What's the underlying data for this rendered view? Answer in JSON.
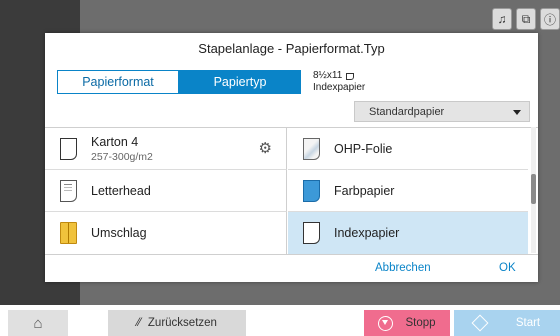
{
  "dialog": {
    "title": "Stapelanlage - Papierformat.Typ",
    "tabs": [
      {
        "label": "Papierformat",
        "active": false
      },
      {
        "label": "Papiertyp",
        "active": true
      }
    ],
    "paper_info": {
      "size": "8½x11",
      "type": "Indexpapier"
    },
    "dropdown_value": "Standardpapier",
    "paper_types": [
      {
        "label": "Karton 4",
        "sub": "257-300g/m2",
        "icon": "document-icon",
        "settings_icon": "gear-icon",
        "selected": false
      },
      {
        "label": "OHP-Folie",
        "icon": "transparency-icon",
        "selected": false
      },
      {
        "label": "Letterhead",
        "icon": "letterhead-icon",
        "selected": false
      },
      {
        "label": "Farbpapier",
        "icon": "colored-paper-icon",
        "selected": false
      },
      {
        "label": "Umschlag",
        "icon": "envelope-icon",
        "selected": false
      },
      {
        "label": "Indexpapier",
        "icon": "document-icon",
        "selected": true
      }
    ],
    "cancel_label": "Abbrechen",
    "ok_label": "OK"
  },
  "top_icons": [
    "bell-icon",
    "paper-jam-icon",
    "info-icon"
  ],
  "bottom_bar": {
    "home_icon": "home-icon",
    "reset_label": "Zurücksetzen",
    "stop_label": "Stopp",
    "start_label": "Start"
  },
  "colors": {
    "accent": "#0a84c8",
    "selected_row": "#cfe6f5",
    "stop": "#f06c8e",
    "start": "#a9d3ef"
  }
}
